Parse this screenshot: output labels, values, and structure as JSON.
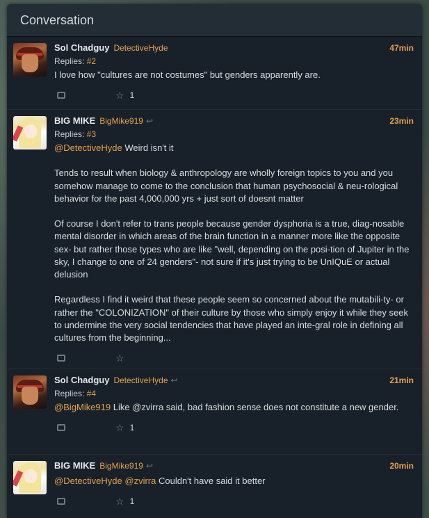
{
  "header": {
    "title": "Conversation"
  },
  "tweets": [
    {
      "avatar": "sol",
      "name": "Sol Chadguy",
      "handle": "DetectiveHyde",
      "reply_icon": false,
      "time": "47min",
      "replies_label": "Replies:",
      "replies_num": "#2",
      "mentions": [],
      "text": "I love how \"cultures are not costumes\" but genders apparently are.",
      "likes": "1"
    },
    {
      "avatar": "mike",
      "name": "BIG MIKE",
      "handle": "BigMike919",
      "reply_icon": true,
      "time": "23min",
      "replies_label": "Replies:",
      "replies_num": "#3",
      "mentions": [
        "@DetectiveHyde"
      ],
      "text": "Weird isn't it\n\nTends to result when biology & anthropology are wholly foreign topics to you and you somehow manage to come to the conclusion that human psychosocial & neu-rological behavior for the past 4,000,000 yrs + just sort of doesnt matter\n\nOf course I don't refer to trans people because gender dysphoria is a true, diag-nosable mental disorder in which areas of the brain function in a manner more like the opposite sex- but rather those types who are like \"well, depending on the posi-tion of Jupiter in the sky, I change to one of 24 genders\"- not sure if it's just trying to be UnIQuE or actual delusion\n\nRegardless I find it weird that these people seem so concerned about the mutabili-ty- or rather the \"COLONIZATION\" of their culture by those who simply enjoy it while they seek to undermine the very social tendencies that have played an inte-gral role in defining all cultures from the beginning...",
      "likes": ""
    },
    {
      "avatar": "sol",
      "name": "Sol Chadguy",
      "handle": "DetectiveHyde",
      "reply_icon": true,
      "time": "21min",
      "replies_label": "Replies:",
      "replies_num": "#4",
      "mentions": [
        "@BigMike919"
      ],
      "text": "Like @zvirra said, bad fashion sense does not constitute a new gender.",
      "likes": "1"
    },
    {
      "avatar": "mike",
      "name": "BIG MIKE",
      "handle": "BigMike919",
      "reply_icon": true,
      "time": "20min",
      "replies_label": "",
      "replies_num": "",
      "mentions": [
        "@DetectiveHyde",
        "@zvirra"
      ],
      "text": "Couldn't have said it better",
      "likes": "1"
    }
  ],
  "colors": {
    "accent": "#e7a04a",
    "panel": "#141c24",
    "text": "#d8dce0"
  },
  "icons": {
    "retweet": "retweet-icon",
    "like": "star-icon",
    "reply": "reply-arrow-icon"
  }
}
